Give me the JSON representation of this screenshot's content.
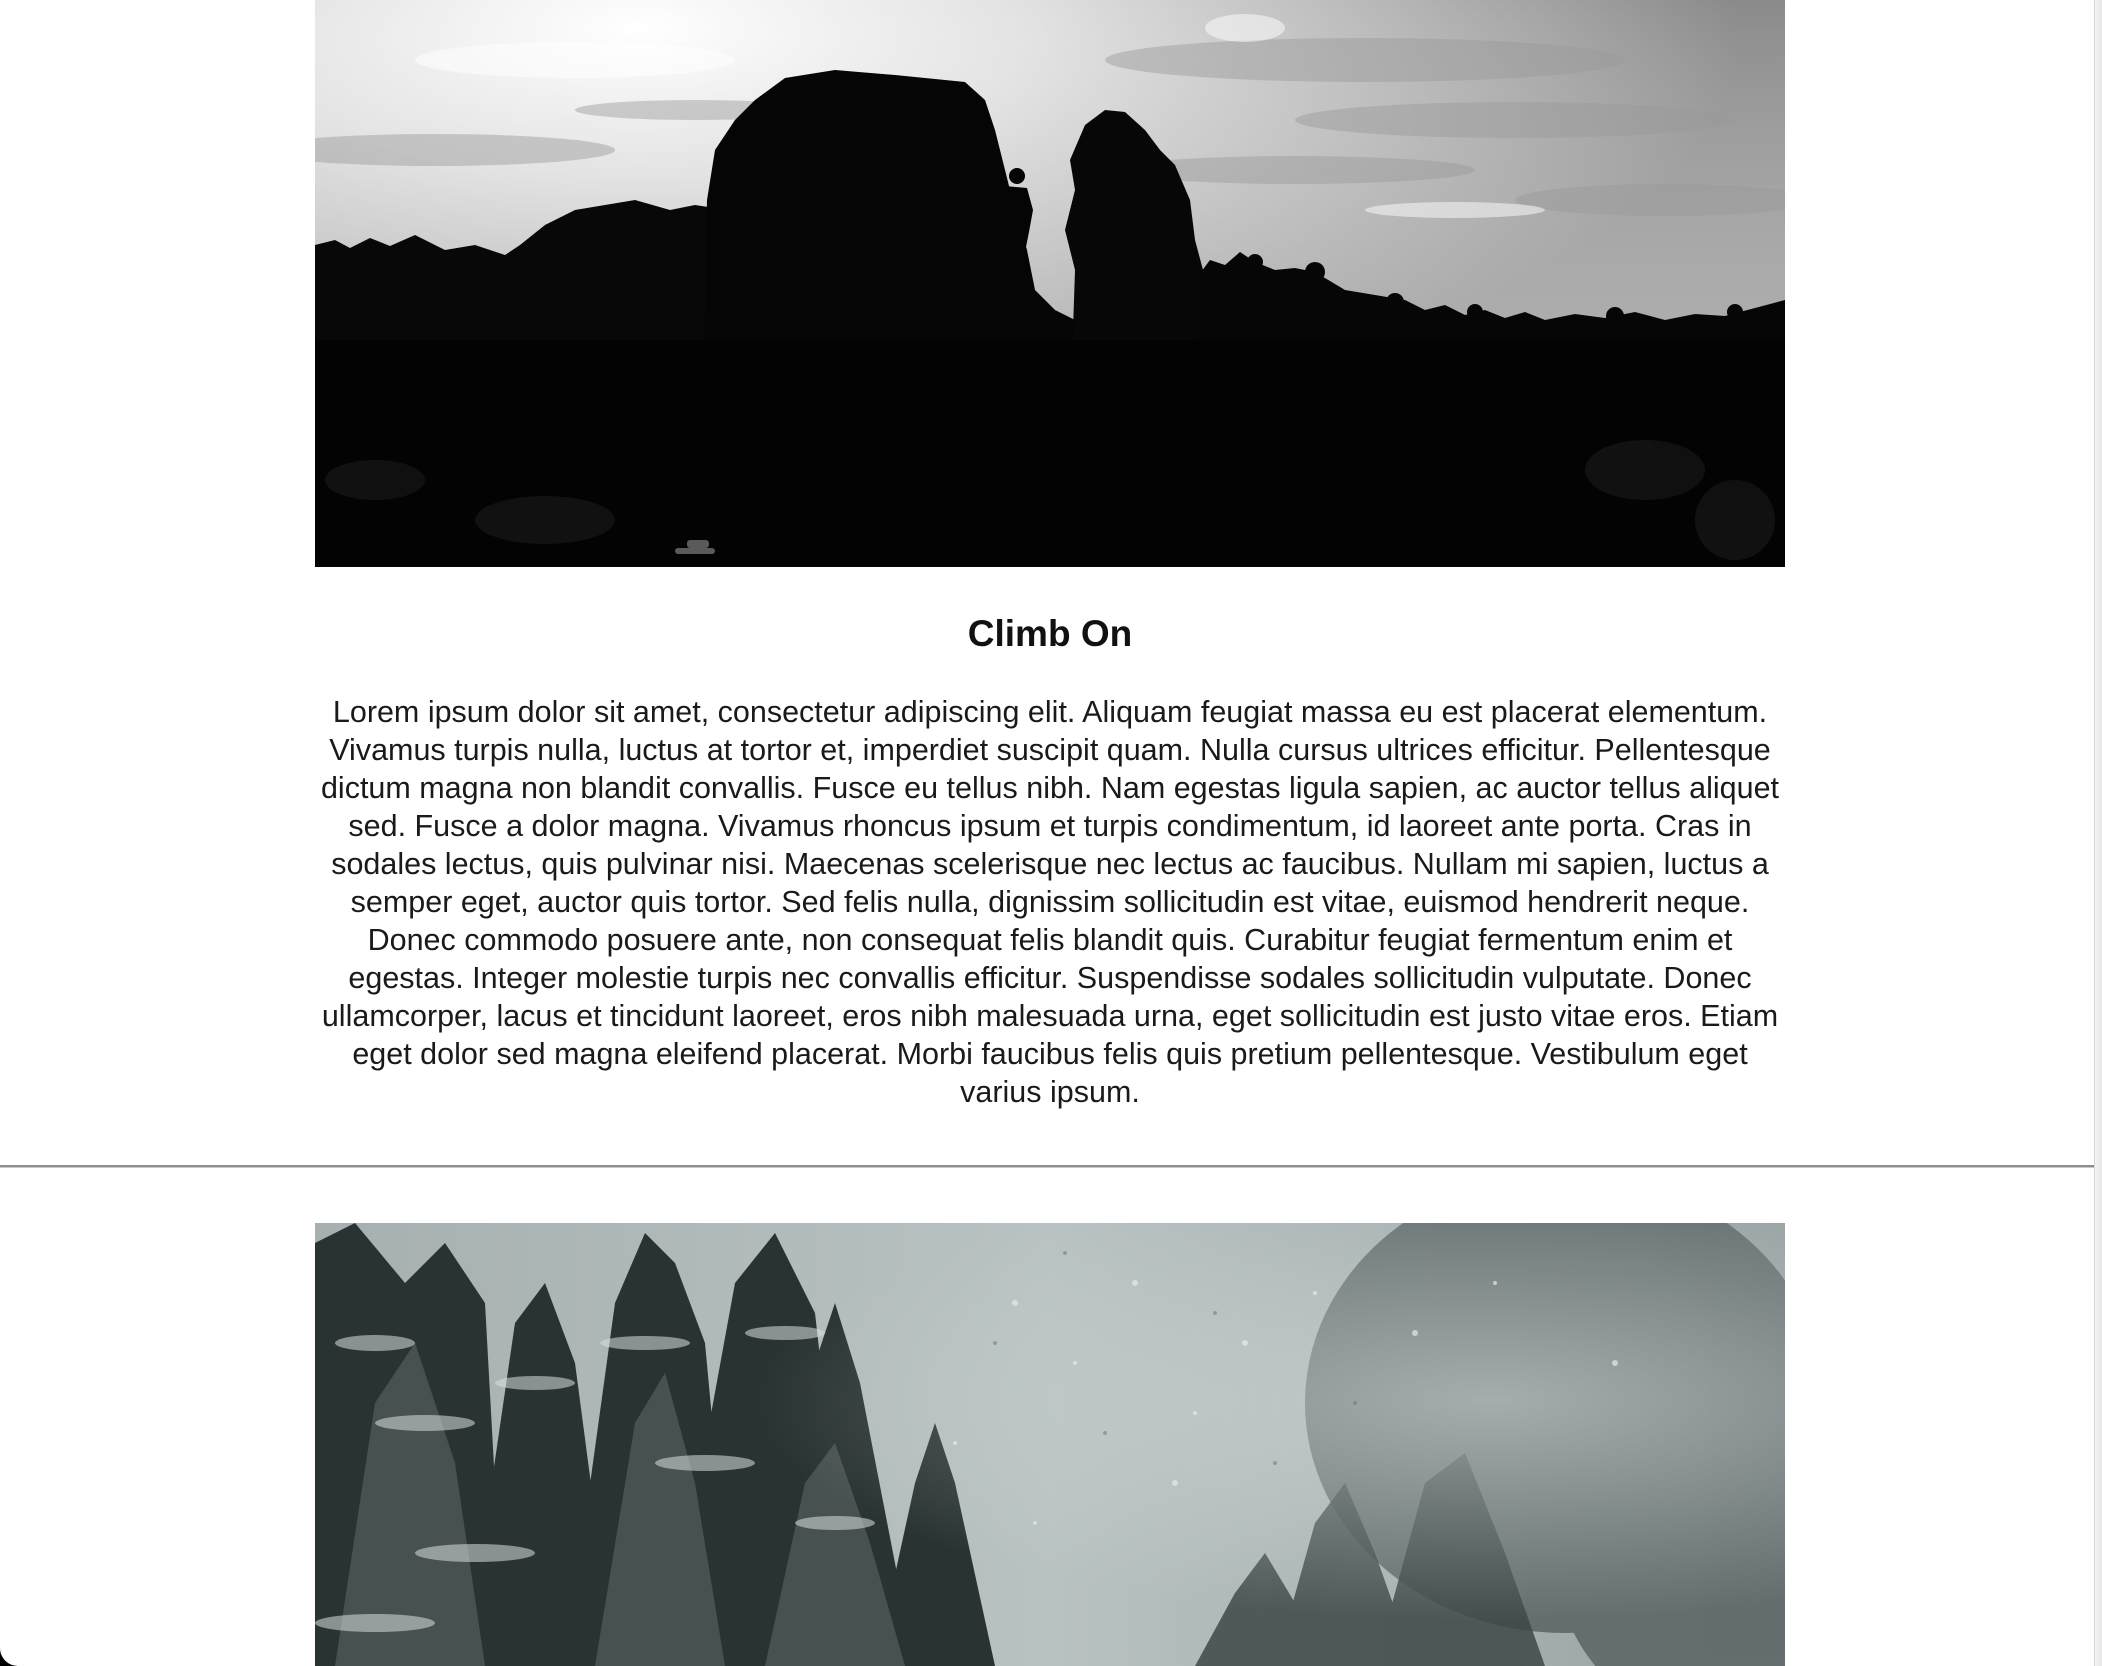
{
  "article": {
    "title": "Climb On",
    "body": "Lorem ipsum dolor sit amet, consectetur adipiscing elit. Aliquam feugiat massa eu est placerat elementum. Vivamus turpis nulla, luctus at tortor et, imperdiet suscipit quam. Nulla cursus ultrices efficitur. Pellentesque dictum magna non blandit convallis. Fusce eu tellus nibh. Nam egestas ligula sapien, ac auctor tellus aliquet sed. Fusce a dolor magna. Vivamus rhoncus ipsum et turpis condimentum, id laoreet ante porta. Cras in sodales lectus, quis pulvinar nisi. Maecenas scelerisque nec lectus ac faucibus. Nullam mi sapien, luctus a semper eget, auctor quis tortor. Sed felis nulla, dignissim sollicitudin est vitae, euismod hendrerit neque. Donec commodo posuere ante, non consequat felis blandit quis. Curabitur feugiat fermentum enim et egestas. Integer molestie turpis nec convallis efficitur. Suspendisse sodales sollicitudin vulputate. Donec ullamcorper, lacus et tincidunt laoreet, eros nibh malesuada urna, eget sollicitudin est justo vitae eros. Etiam eget dolor sed magna eleifend placerat. Morbi faucibus felis quis pretium pellentesque. Vestibulum eget varius ipsum."
  },
  "images": {
    "climb": "climber-silhouette-photo",
    "snow": "snowy-forest-photo"
  },
  "colors": {
    "text": "#111111",
    "divider": "#8d8d8d",
    "background": "#ffffff"
  }
}
